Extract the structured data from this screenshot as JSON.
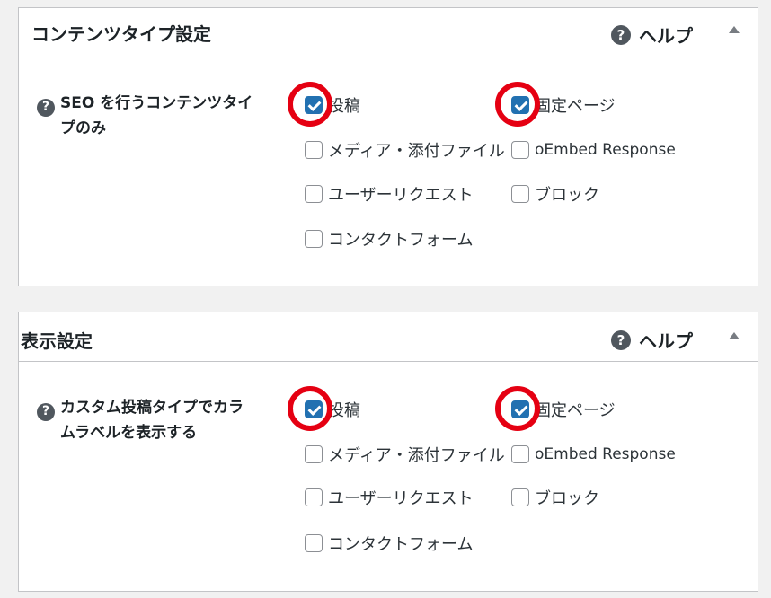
{
  "panels": [
    {
      "title": "コンテンツタイプ設定",
      "help_label": "ヘルプ",
      "help_icon": "question-circle-icon",
      "field_label_line1": "SEO を行うコンテンツタイ",
      "field_label_line2": "プのみ",
      "options": [
        {
          "label": "投稿",
          "checked": true
        },
        {
          "label": "固定ページ",
          "checked": true
        },
        {
          "label": "メディア・添付ファイル",
          "checked": false
        },
        {
          "label": "oEmbed Response",
          "checked": false
        },
        {
          "label": "ユーザーリクエスト",
          "checked": false
        },
        {
          "label": "ブロック",
          "checked": false
        },
        {
          "label": "コンタクトフォーム",
          "checked": false
        }
      ]
    },
    {
      "title": "表示設定",
      "help_label": "ヘルプ",
      "help_icon": "question-circle-icon",
      "field_label_line1": "カスタム投稿タイプでカラ",
      "field_label_line2": "ムラベルを表示する",
      "options": [
        {
          "label": "投稿",
          "checked": true
        },
        {
          "label": "固定ページ",
          "checked": true
        },
        {
          "label": "メディア・添付ファイル",
          "checked": false
        },
        {
          "label": "oEmbed Response",
          "checked": false
        },
        {
          "label": "ユーザーリクエスト",
          "checked": false
        },
        {
          "label": "ブロック",
          "checked": false
        },
        {
          "label": "コンタクトフォーム",
          "checked": false
        }
      ]
    }
  ],
  "colors": {
    "checkbox_checked": "#2271b1",
    "highlight_circle": "#e50012",
    "panel_border": "#c3c4c7",
    "background": "#f1f1f1"
  }
}
